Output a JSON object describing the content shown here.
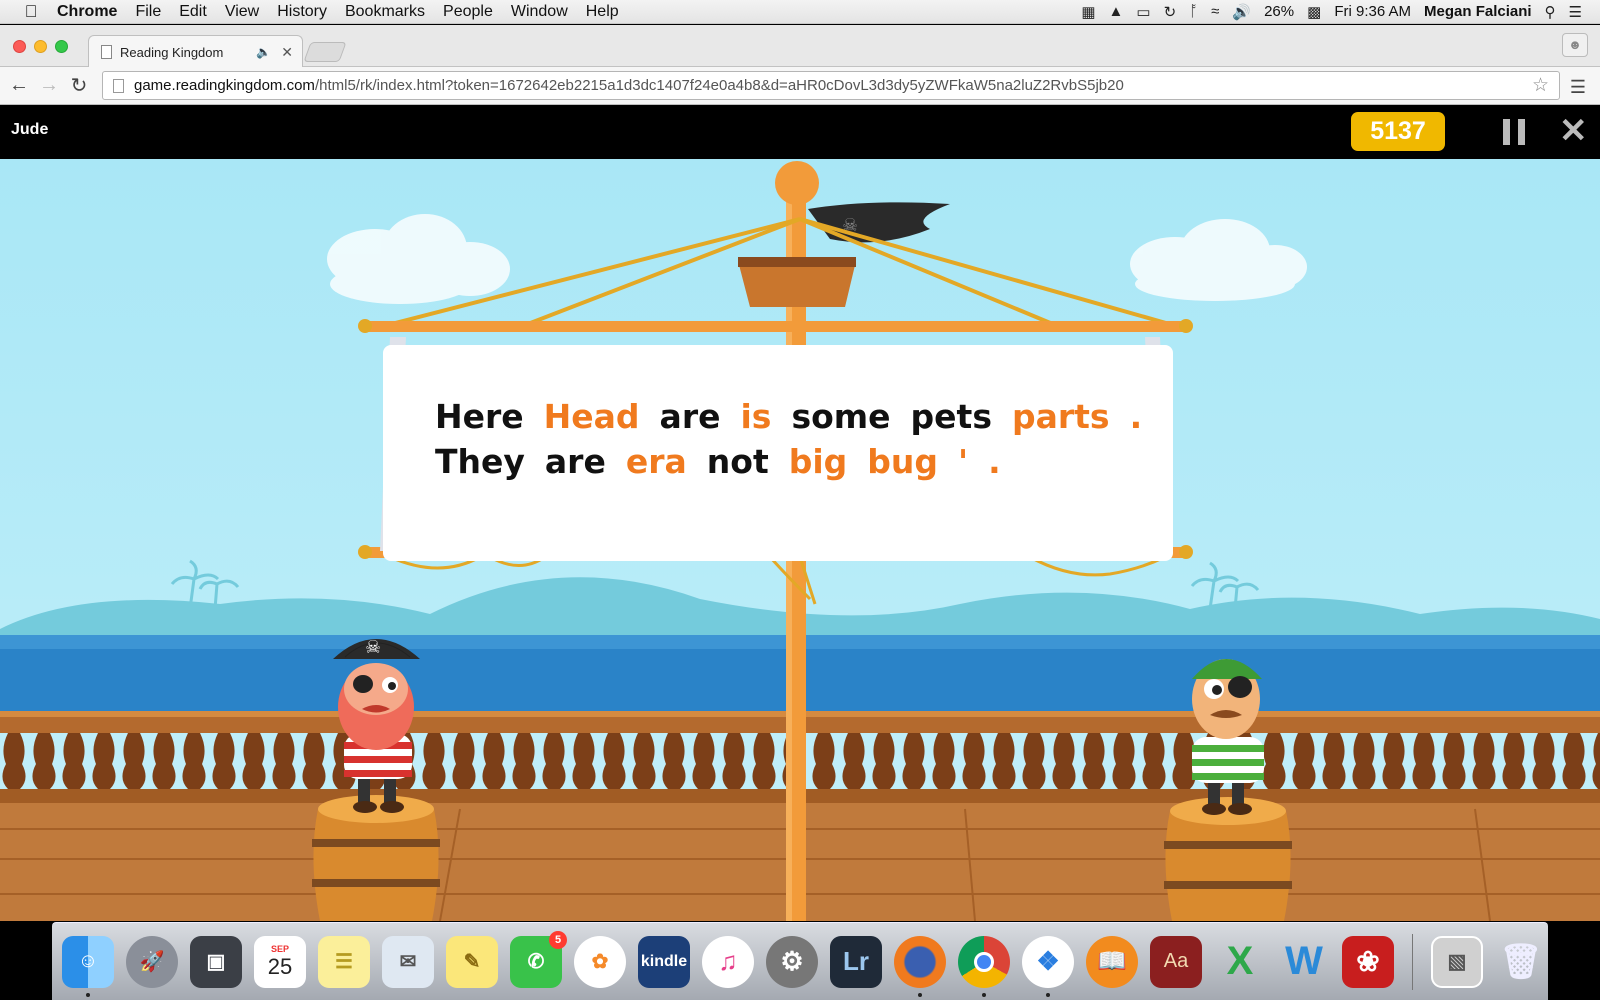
{
  "menubar": {
    "app_name": "Chrome",
    "menus": [
      "File",
      "Edit",
      "View",
      "History",
      "Bookmarks",
      "People",
      "Window",
      "Help"
    ],
    "battery": "26%",
    "clock": "Fri 9:36 AM",
    "user": "Megan Falciani"
  },
  "browser": {
    "tab_title": "Reading Kingdom",
    "url_host": "game.readingkingdom.com",
    "url_path": "/html5/rk/index.html?token=1672642eb2215a1d3dc1407f24e0a4b8&d=aHR0cDovL3d3dy5yZWFkaW5na2luZ2RvbS5jb20"
  },
  "game": {
    "player_name": "Jude",
    "score": "5137",
    "banner": {
      "line1": [
        {
          "text": "Here",
          "highlight": false
        },
        {
          "text": "Head",
          "highlight": true
        },
        {
          "text": "are",
          "highlight": false
        },
        {
          "text": "is",
          "highlight": true
        },
        {
          "text": "some",
          "highlight": false
        },
        {
          "text": "pets",
          "highlight": false
        },
        {
          "text": "parts",
          "highlight": true
        },
        {
          "text": ".",
          "highlight": true
        }
      ],
      "line2": [
        {
          "text": "They",
          "highlight": false
        },
        {
          "text": "are",
          "highlight": false
        },
        {
          "text": "era",
          "highlight": true
        },
        {
          "text": "not",
          "highlight": false
        },
        {
          "text": "big",
          "highlight": true
        },
        {
          "text": "bug",
          "highlight": true
        },
        {
          "text": "'",
          "highlight": true
        },
        {
          "text": ".",
          "highlight": true
        }
      ]
    },
    "colors": {
      "highlight": "#f07a1e",
      "score_badge": "#f0b800"
    }
  },
  "dock": {
    "calendar_month": "SEP",
    "calendar_day": "25",
    "facetime_badge": "5",
    "kindle_label": "kindle",
    "lightroom_label": "Lr",
    "dictionary_label": "Aa",
    "icons": [
      "finder-icon",
      "launchpad-icon",
      "image-capture-icon",
      "calendar-icon",
      "notes-icon",
      "preview-icon",
      "stickies-icon",
      "facetime-icon",
      "photos-icon",
      "kindle-icon",
      "itunes-icon",
      "system-preferences-icon",
      "lightroom-icon",
      "firefox-icon",
      "chrome-icon",
      "safari-icon",
      "ibooks-icon",
      "dictionary-icon",
      "excel-icon",
      "word-icon",
      "acrobat-icon",
      "photo-stack-icon",
      "trash-icon"
    ]
  }
}
